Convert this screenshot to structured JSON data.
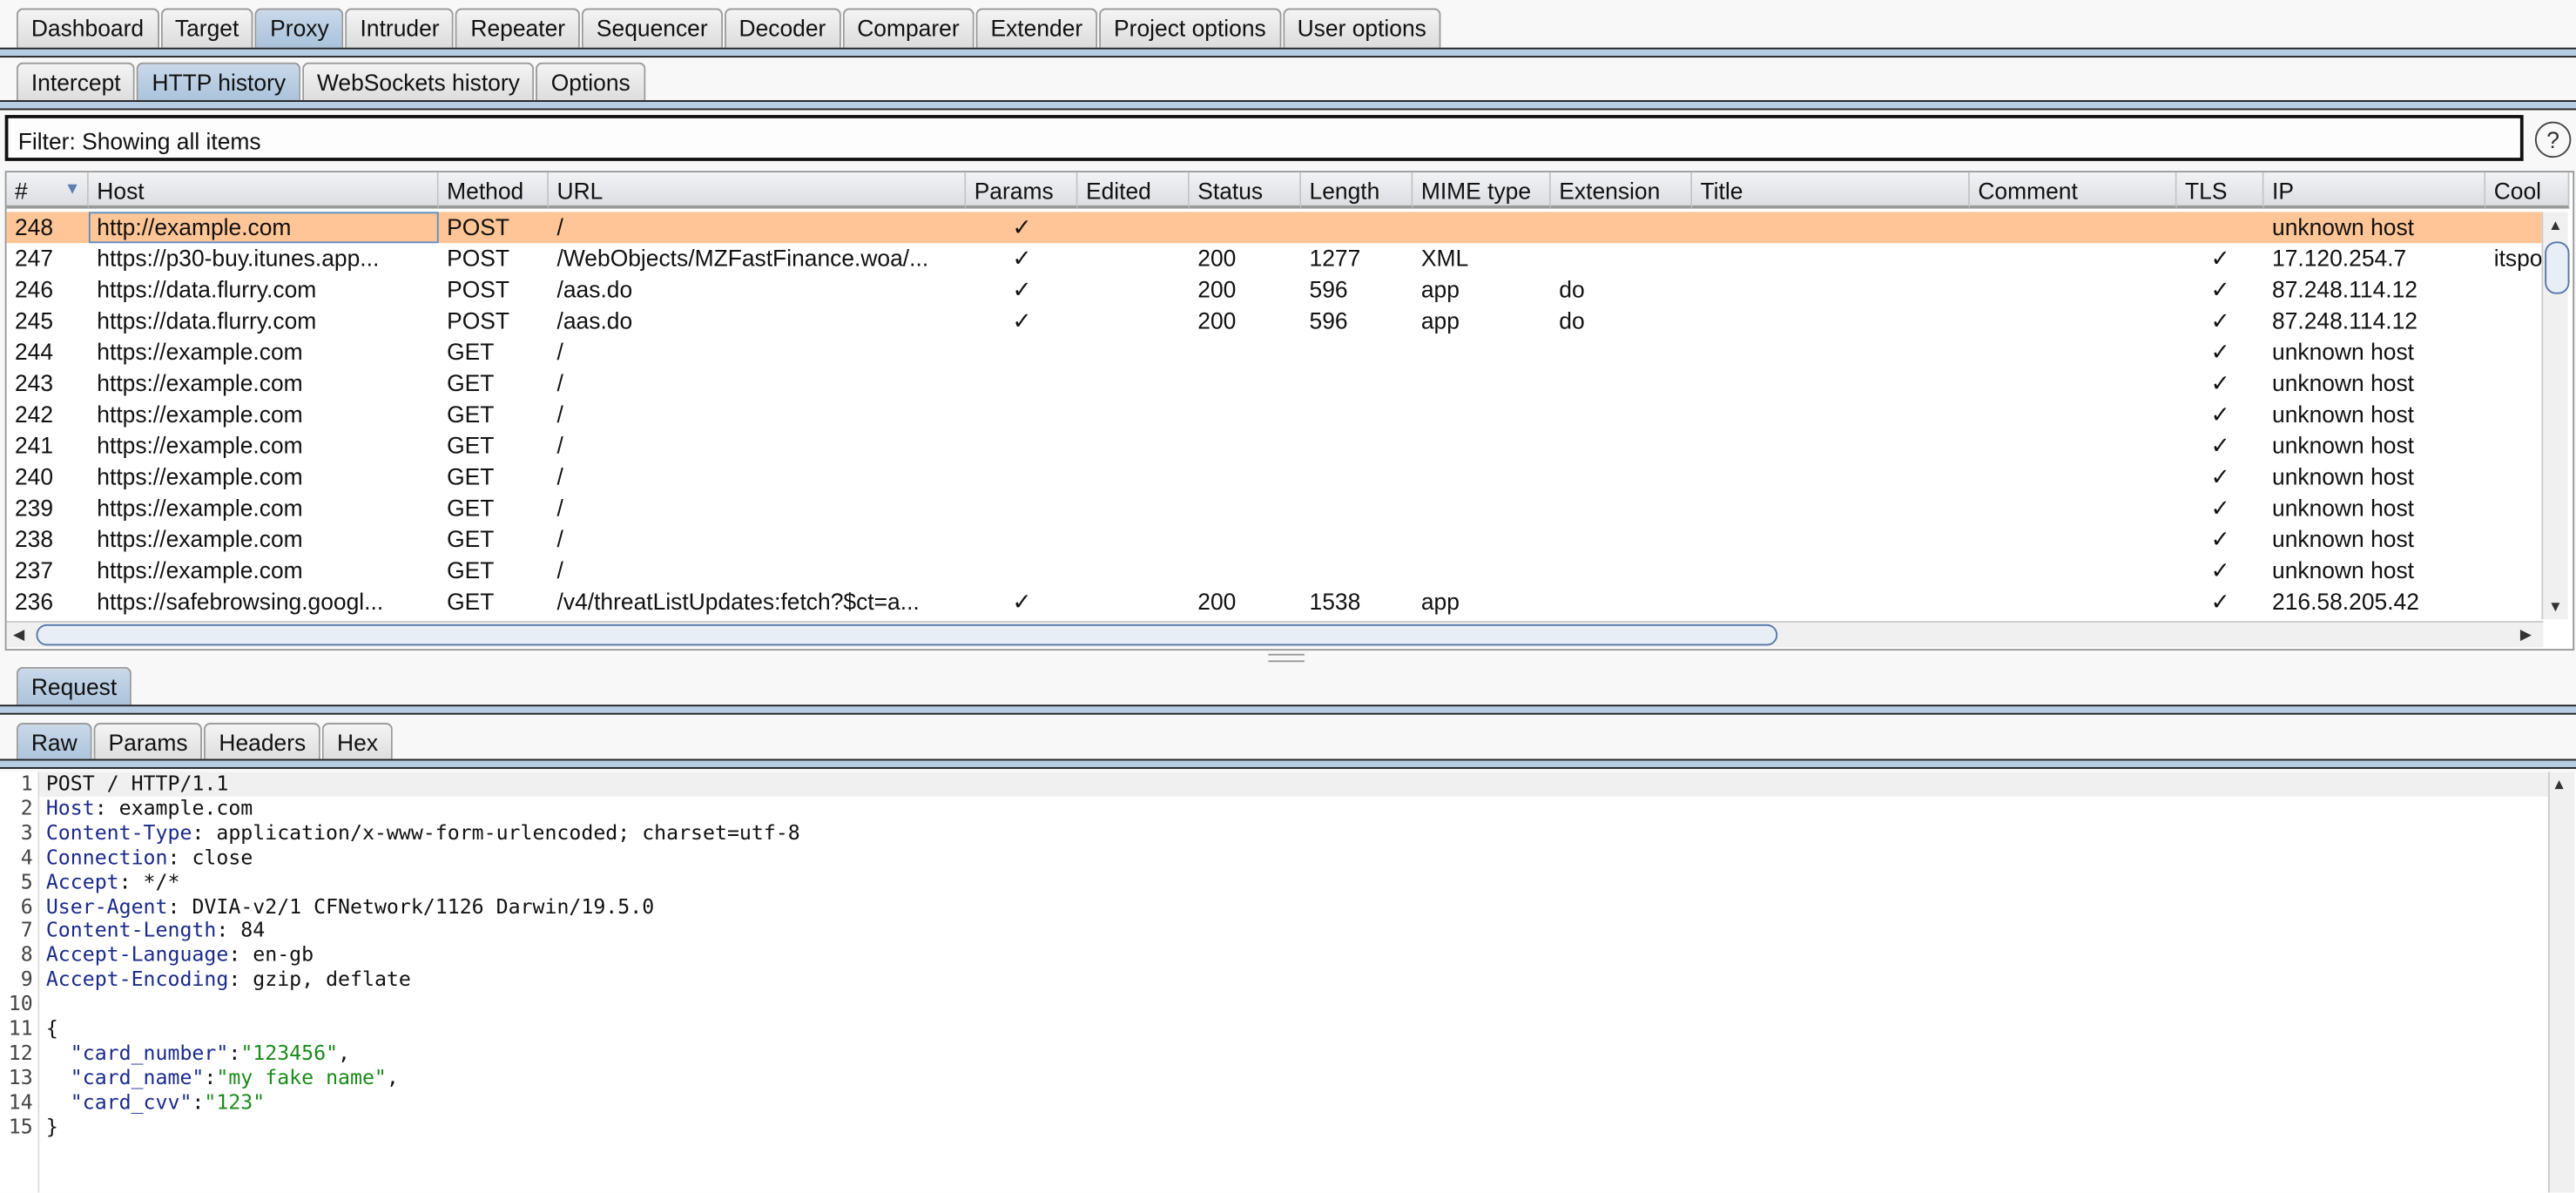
{
  "main_tabs": [
    {
      "label": "Dashboard"
    },
    {
      "label": "Target"
    },
    {
      "label": "Proxy",
      "selected": true
    },
    {
      "label": "Intruder"
    },
    {
      "label": "Repeater"
    },
    {
      "label": "Sequencer"
    },
    {
      "label": "Decoder"
    },
    {
      "label": "Comparer"
    },
    {
      "label": "Extender"
    },
    {
      "label": "Project options"
    },
    {
      "label": "User options"
    }
  ],
  "proxy_tabs": [
    {
      "label": "Intercept"
    },
    {
      "label": "HTTP history",
      "selected": true
    },
    {
      "label": "WebSockets history"
    },
    {
      "label": "Options"
    }
  ],
  "filter": {
    "text": "Filter: Showing all items",
    "help_icon": "question-circle-icon"
  },
  "table": {
    "sort_icon": "sort-descending-arrow-icon",
    "columns": [
      "#",
      "Host",
      "Method",
      "URL",
      "Params",
      "Edited",
      "Status",
      "Length",
      "MIME type",
      "Extension",
      "Title",
      "Comment",
      "TLS",
      "IP",
      "Cool"
    ],
    "rows": [
      [
        "248",
        "http://example.com",
        "POST",
        "/",
        "✓",
        "",
        "",
        "",
        "",
        "",
        "",
        "",
        "",
        "unknown host",
        ""
      ],
      [
        "247",
        "https://p30-buy.itunes.app...",
        "POST",
        "/WebObjects/MZFastFinance.woa/...",
        "✓",
        "",
        "200",
        "1277",
        "XML",
        "",
        "",
        "",
        "✓",
        "17.120.254.7",
        "itspo"
      ],
      [
        "246",
        "https://data.flurry.com",
        "POST",
        "/aas.do",
        "✓",
        "",
        "200",
        "596",
        "app",
        "do",
        "",
        "",
        "✓",
        "87.248.114.12",
        ""
      ],
      [
        "245",
        "https://data.flurry.com",
        "POST",
        "/aas.do",
        "✓",
        "",
        "200",
        "596",
        "app",
        "do",
        "",
        "",
        "✓",
        "87.248.114.12",
        ""
      ],
      [
        "244",
        "https://example.com",
        "GET",
        "/",
        "",
        "",
        "",
        "",
        "",
        "",
        "",
        "",
        "✓",
        "unknown host",
        ""
      ],
      [
        "243",
        "https://example.com",
        "GET",
        "/",
        "",
        "",
        "",
        "",
        "",
        "",
        "",
        "",
        "✓",
        "unknown host",
        ""
      ],
      [
        "242",
        "https://example.com",
        "GET",
        "/",
        "",
        "",
        "",
        "",
        "",
        "",
        "",
        "",
        "✓",
        "unknown host",
        ""
      ],
      [
        "241",
        "https://example.com",
        "GET",
        "/",
        "",
        "",
        "",
        "",
        "",
        "",
        "",
        "",
        "✓",
        "unknown host",
        ""
      ],
      [
        "240",
        "https://example.com",
        "GET",
        "/",
        "",
        "",
        "",
        "",
        "",
        "",
        "",
        "",
        "✓",
        "unknown host",
        ""
      ],
      [
        "239",
        "https://example.com",
        "GET",
        "/",
        "",
        "",
        "",
        "",
        "",
        "",
        "",
        "",
        "✓",
        "unknown host",
        ""
      ],
      [
        "238",
        "https://example.com",
        "GET",
        "/",
        "",
        "",
        "",
        "",
        "",
        "",
        "",
        "",
        "✓",
        "unknown host",
        ""
      ],
      [
        "237",
        "https://example.com",
        "GET",
        "/",
        "",
        "",
        "",
        "",
        "",
        "",
        "",
        "",
        "✓",
        "unknown host",
        ""
      ],
      [
        "236",
        "https://safebrowsing.googl...",
        "GET",
        "/v4/threatListUpdates:fetch?$ct=a...",
        "✓",
        "",
        "200",
        "1538",
        "app",
        "",
        "",
        "",
        "✓",
        "216.58.205.42",
        ""
      ]
    ],
    "selected_row": 0,
    "highlight_color": "#ffc596"
  },
  "request_tabs": [
    {
      "label": "Request",
      "selected": true
    }
  ],
  "view_tabs": [
    {
      "label": "Raw",
      "selected": true
    },
    {
      "label": "Params"
    },
    {
      "label": "Headers"
    },
    {
      "label": "Hex"
    }
  ],
  "request_lines": [
    {
      "key": "",
      "value": "POST / HTTP/1.1"
    },
    {
      "key": "Host",
      "value": " example.com"
    },
    {
      "key": "Content-Type",
      "value": " application/x-www-form-urlencoded; charset=utf-8"
    },
    {
      "key": "Connection",
      "value": " close"
    },
    {
      "key": "Accept",
      "value": " */*"
    },
    {
      "key": "User-Agent",
      "value": " DVIA-v2/1 CFNetwork/1126 Darwin/19.5.0"
    },
    {
      "key": "Content-Length",
      "value": " 84"
    },
    {
      "key": "Accept-Language",
      "value": " en-gb"
    },
    {
      "key": "Accept-Encoding",
      "value": " gzip, deflate"
    },
    {
      "key": "",
      "value": ""
    },
    {
      "key": "",
      "value": "{"
    },
    {
      "jkey": "  \"card_number\"",
      "jval": "\"123456\"",
      "tail": ","
    },
    {
      "jkey": "  \"card_name\"",
      "jval": "\"my fake name\"",
      "tail": ","
    },
    {
      "jkey": "  \"card_cvv\"",
      "jval": "\"123\"",
      "tail": ""
    },
    {
      "key": "",
      "value": "}"
    }
  ]
}
